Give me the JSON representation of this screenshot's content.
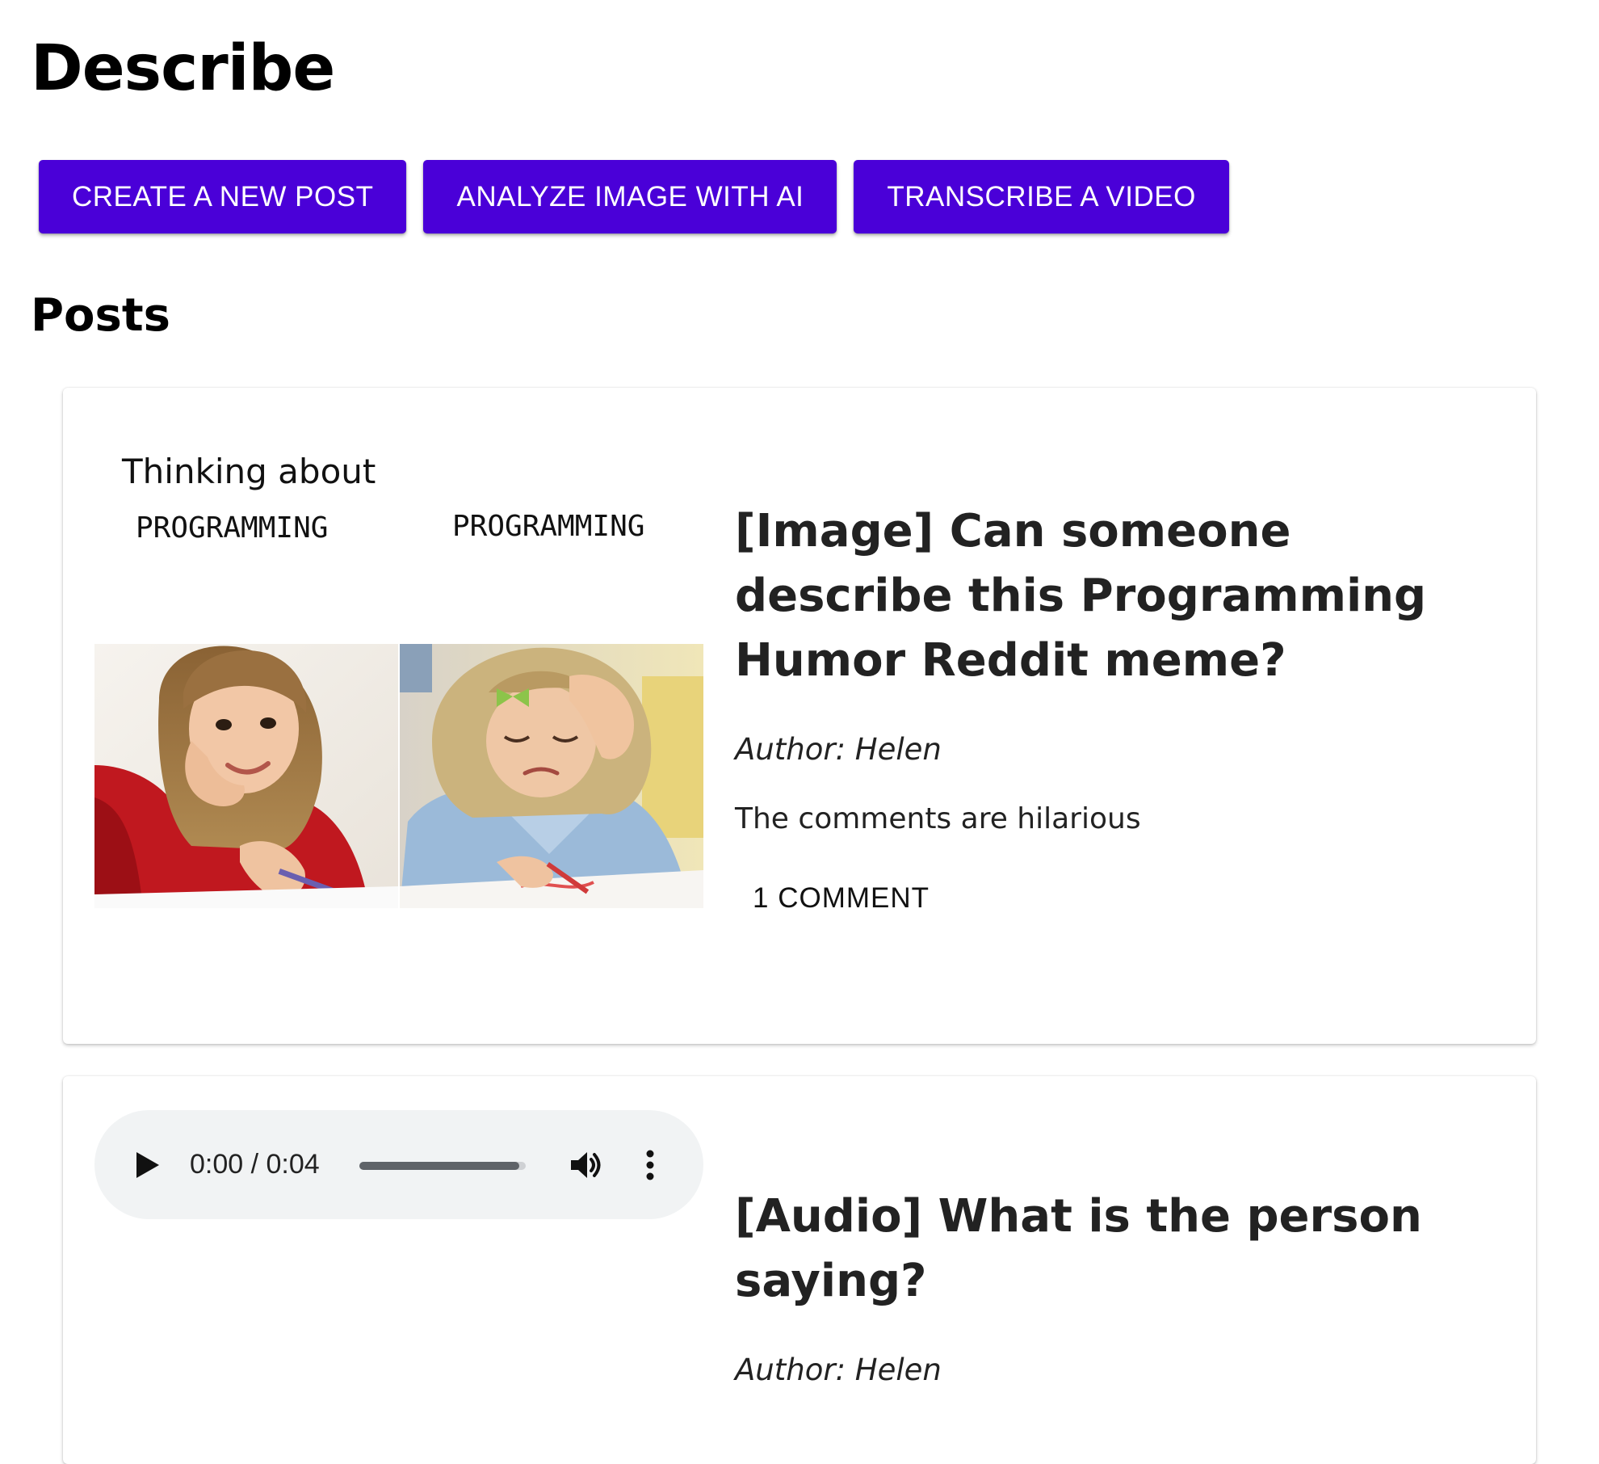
{
  "app": {
    "title": "Describe"
  },
  "actions": {
    "create_post": "CREATE A NEW POST",
    "analyze_image": "ANALYZE IMAGE WITH AI",
    "transcribe_video": "TRANSCRIBE A VIDEO"
  },
  "colors": {
    "primary_button": "#4a00d8",
    "audio_player_bg": "#f1f3f4"
  },
  "posts_section": {
    "title": "Posts",
    "posts": [
      {
        "media_type": "image",
        "meme": {
          "caption_top": "Thinking about",
          "caption_left": "PROGRAMMING",
          "caption_right": "PROGRAMMING"
        },
        "title": "[Image] Can someone describe this Programming Humor Reddit meme?",
        "author": "Author: Helen",
        "text": "The comments are hilarious",
        "comments_label": "1 COMMENT"
      },
      {
        "media_type": "audio",
        "audio": {
          "time": "0:00 / 0:04",
          "progress": 0.96,
          "play_icon": "play-icon",
          "volume_icon": "volume-icon",
          "more_icon": "more-vertical-icon"
        },
        "title": "[Audio] What is the person saying?",
        "author": "Author: Helen"
      }
    ]
  }
}
